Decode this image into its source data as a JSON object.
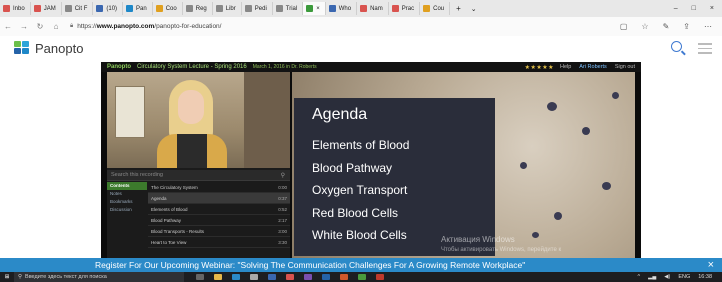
{
  "browser": {
    "tabs": [
      {
        "label": "Inbo",
        "color": "#d9534f"
      },
      {
        "label": "JAM",
        "color": "#d9534f"
      },
      {
        "label": "Cit F",
        "color": "#888888"
      },
      {
        "label": "(10)",
        "color": "#3a67b0"
      },
      {
        "label": "Pan",
        "color": "#1e88c8"
      },
      {
        "label": "Coo",
        "color": "#e0a020"
      },
      {
        "label": "Reg",
        "color": "#888888"
      },
      {
        "label": "Libr",
        "color": "#888888"
      },
      {
        "label": "Pedi",
        "color": "#888888"
      },
      {
        "label": "Trial",
        "color": "#888888"
      },
      {
        "label": "×",
        "color": "#3c9a3c",
        "active": true
      },
      {
        "label": "Who",
        "color": "#3a67b0"
      },
      {
        "label": "Nam",
        "color": "#d9534f"
      },
      {
        "label": "Prac",
        "color": "#d9534f"
      },
      {
        "label": "Cou",
        "color": "#e0a020"
      }
    ],
    "new_tab": "+",
    "tab_menu": "⌄",
    "window_controls": [
      "–",
      "□",
      "×"
    ],
    "url_prefix": "https://",
    "url_host": "www.panopto.com",
    "url_path": "/panopto-for-education/",
    "nav": [
      "←",
      "→",
      "↻",
      "⌂"
    ],
    "right_icons": [
      "▢",
      "☆",
      "✎",
      "⇪",
      "⋯"
    ]
  },
  "site": {
    "brand": "Panopto",
    "logo_colors": [
      "#6cc04a",
      "#2ba5d9",
      "#2563a8",
      "#1e88c8"
    ]
  },
  "player": {
    "brand": "Panopto",
    "title": "Circulatory System Lecture - Spring 2016",
    "subtitle": "March 1, 2016 in Dr. Roberts",
    "stars": "★★★★★",
    "tools": [
      "Help",
      "Ari Roberts",
      "Sign out"
    ],
    "search_placeholder": "Search this recording",
    "side_tabs": [
      "Contents",
      "Notes",
      "Bookmarks",
      "Discussion"
    ],
    "agenda_rows": [
      {
        "title": "The Circulatory System",
        "time": "0:00"
      },
      {
        "title": "Agenda",
        "time": "0:37"
      },
      {
        "title": "Elements of Blood",
        "time": "0:52"
      },
      {
        "title": "Blood Pathway",
        "time": "2:17"
      },
      {
        "title": "Blood Transports - Results",
        "time": "3:00"
      },
      {
        "title": "Heart to Toe View",
        "time": "3:30"
      }
    ],
    "slide": {
      "title": "Agenda",
      "items": [
        "Elements of Blood",
        "Blood Pathway",
        "Oxygen Transport",
        "Red Blood Cells",
        "White Blood Cells"
      ]
    }
  },
  "watermark": {
    "line1": "Активация Windows",
    "line2": "Чтобы активировать Windows, перейдите к"
  },
  "promo": {
    "text": "Register For Our Upcoming Webinar: \"Solving The Communication Challenges For A Growing Remote Workplace\"",
    "close": "×"
  },
  "taskbar": {
    "search_placeholder": "Введите здесь текст для поиска",
    "lang": "ENG",
    "time": "16:38"
  }
}
